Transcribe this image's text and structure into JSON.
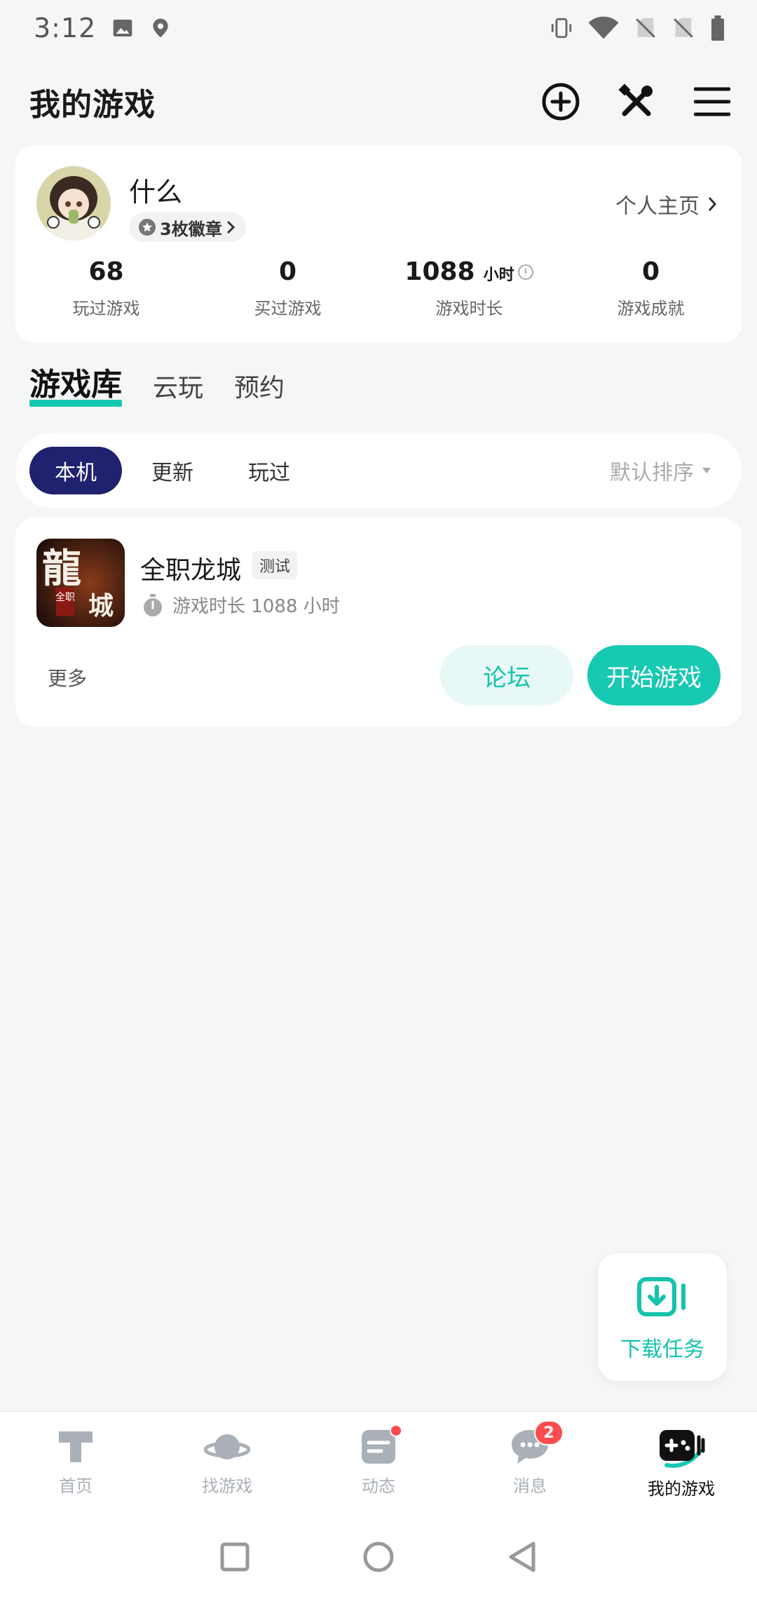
{
  "status_bar": {
    "time": "3:12",
    "left_icons": [
      "image-icon",
      "location-shield-icon"
    ],
    "right_icons": [
      "vibrate-icon",
      "wifi-icon",
      "no-sim-icon",
      "no-sim-icon",
      "battery-icon"
    ]
  },
  "header": {
    "title": "我的游戏",
    "actions": [
      "add-circle-icon",
      "tools-icon",
      "menu-icon"
    ]
  },
  "profile": {
    "username": "什么",
    "badge_label": "3枚徽章",
    "homepage_label": "个人主页",
    "stats": [
      {
        "value": "68",
        "unit": "",
        "label": "玩过游戏"
      },
      {
        "value": "0",
        "unit": "",
        "label": "买过游戏"
      },
      {
        "value": "1088",
        "unit": "小时",
        "label": "游戏时长"
      },
      {
        "value": "0",
        "unit": "",
        "label": "游戏成就"
      }
    ]
  },
  "library_tabs": [
    {
      "label": "游戏库",
      "active": true
    },
    {
      "label": "云玩",
      "active": false
    },
    {
      "label": "预约",
      "active": false
    }
  ],
  "filters": {
    "chips": [
      {
        "label": "本机",
        "active": true
      },
      {
        "label": "更新",
        "active": false
      },
      {
        "label": "玩过",
        "active": false
      }
    ],
    "sort_label": "默认排序"
  },
  "games": [
    {
      "name": "全职龙城",
      "tag": "测试",
      "playtime": "游戏时长 1088 小时",
      "more_label": "更多",
      "forum_label": "论坛",
      "play_label": "开始游戏",
      "icon_text_main": "龍",
      "icon_text_side": "城",
      "icon_text_small": "全职"
    }
  ],
  "download_task": {
    "label": "下载任务"
  },
  "bottom_nav": [
    {
      "label": "首页",
      "icon": "home-icon",
      "active": false
    },
    {
      "label": "找游戏",
      "icon": "planet-icon",
      "active": false
    },
    {
      "label": "动态",
      "icon": "feed-icon",
      "active": false,
      "dot": true
    },
    {
      "label": "消息",
      "icon": "message-icon",
      "active": false,
      "badge": "2"
    },
    {
      "label": "我的游戏",
      "icon": "gamepad-icon",
      "active": true
    }
  ],
  "colors": {
    "accent": "#17c9b1",
    "chip_active": "#20216f",
    "background": "#f5f6f8",
    "badge_red": "#ff4d4f"
  }
}
